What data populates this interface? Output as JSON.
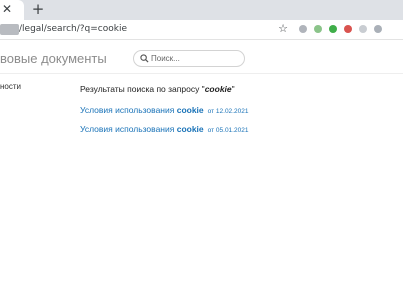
{
  "browser": {
    "tab_close_icon": "close-icon",
    "new_tab_icon": "plus-icon",
    "url": "/legal/search/?q=cookie",
    "bookmark_icon": "star-icon",
    "extension_colors": [
      "#b0b4bb",
      "#8bc48a",
      "#3fae49",
      "#d9534f",
      "#c9cdd2",
      "#aab0b8"
    ]
  },
  "header": {
    "title": "вовые документы",
    "search": {
      "placeholder": "Поиск...",
      "value": ""
    }
  },
  "sidebar": {
    "item_label": "ности"
  },
  "results": {
    "heading_prefix": "Результаты поиска по запросу \"",
    "query": "cookie",
    "heading_suffix": "\"",
    "items": [
      {
        "title": "Условия использования ",
        "highlight": "cookie",
        "date": "от 12.02.2021"
      },
      {
        "title": "Условия использования ",
        "highlight": "cookie",
        "date": "от 05.01.2021"
      }
    ]
  }
}
